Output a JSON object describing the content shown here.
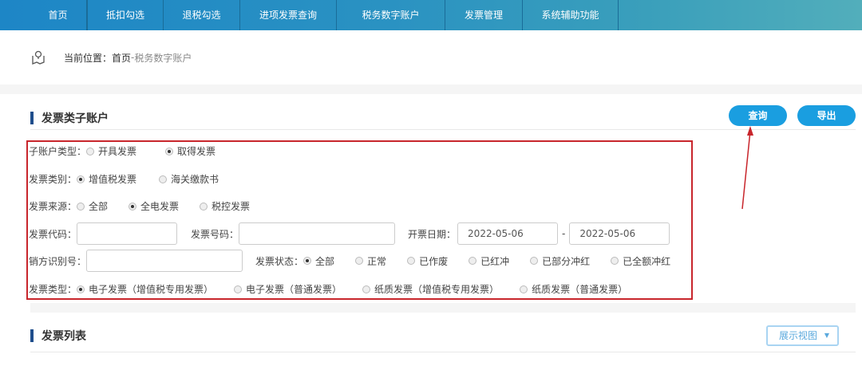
{
  "nav": {
    "items": [
      "首页",
      "抵扣勾选",
      "退税勾选",
      "进项发票查询",
      "税务数字账户",
      "发票管理",
      "系统辅助功能"
    ]
  },
  "breadcrumb": {
    "label": "当前位置：首页",
    "sep": " - ",
    "current": "税务数字账户"
  },
  "section1": {
    "title": "发票类子账户",
    "query_label": "查询",
    "export_label": "导出"
  },
  "filters": {
    "sub_account": {
      "label": "子账户类型：",
      "options": [
        "开具发票",
        "取得发票"
      ],
      "selected": 1
    },
    "category": {
      "label": "发票类别：",
      "options": [
        "增值税发票",
        "海关缴款书"
      ],
      "selected": 0
    },
    "source": {
      "label": "发票来源：",
      "options": [
        "全部",
        "全电发票",
        "税控发票"
      ],
      "selected": 1
    },
    "code": {
      "label": "发票代码：",
      "value": ""
    },
    "number": {
      "label": "发票号码：",
      "value": ""
    },
    "date": {
      "label": "开票日期：",
      "from": "2022-05-06",
      "sep": "-",
      "to": "2022-05-06"
    },
    "seller": {
      "label": "销方识别号：",
      "value": ""
    },
    "status": {
      "label": "发票状态：",
      "options": [
        "全部",
        "正常",
        "已作废",
        "已红冲",
        "已部分冲红",
        "已全额冲红"
      ],
      "selected": 0
    },
    "type": {
      "label": "发票类型：",
      "options": [
        "电子发票（增值税专用发票）",
        "电子发票（普通发票）",
        "纸质发票（增值税专用发票）",
        "纸质发票（普通发票）"
      ],
      "selected": 0
    }
  },
  "section2": {
    "title": "发票列表",
    "view_label": "展示视图"
  },
  "colors": {
    "nav": "#1d86c6",
    "button": "#1a9ee0",
    "highlight": "#c8262c"
  }
}
